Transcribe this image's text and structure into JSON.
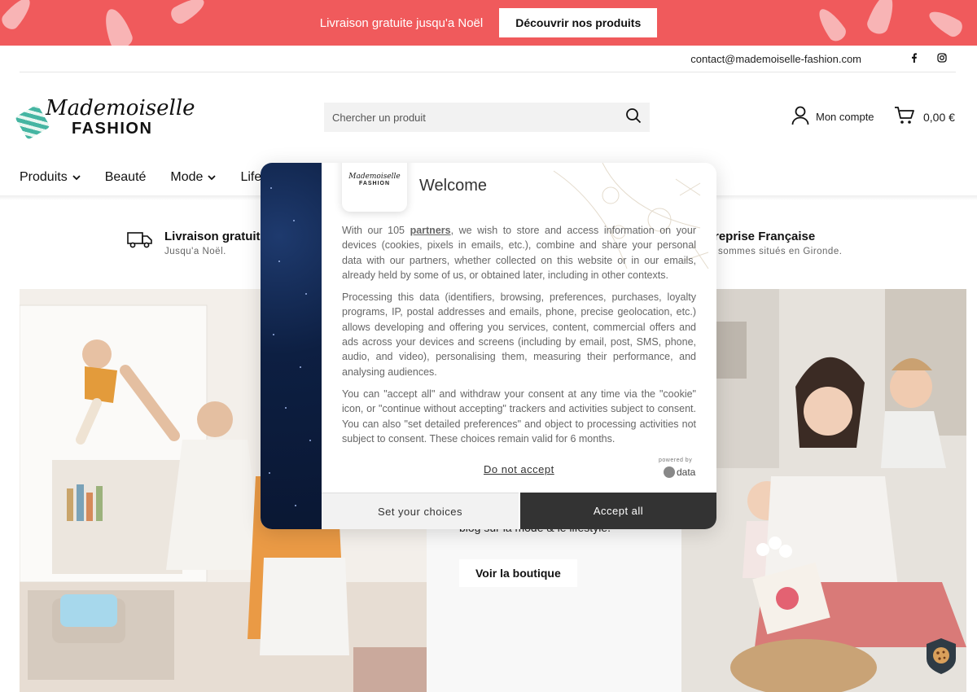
{
  "promo": {
    "text": "Livraison gratuite jusqu'a Noël",
    "button": "Découvrir nos produits"
  },
  "topbar": {
    "contact_email": "contact@mademoiselle-fashion.com",
    "social_icons": [
      "facebook-icon",
      "instagram-icon"
    ]
  },
  "header": {
    "logo_script": "Mademoiselle",
    "logo_word": "FASHION",
    "search_placeholder": "Chercher un produit",
    "account_label": "Mon compte",
    "cart_total": "0,00 €"
  },
  "nav": {
    "items": [
      {
        "label": "Produits",
        "has_dropdown": true
      },
      {
        "label": "Beauté",
        "has_dropdown": false
      },
      {
        "label": "Mode",
        "has_dropdown": true
      },
      {
        "label": "Lifes",
        "has_dropdown": false
      }
    ]
  },
  "features": [
    {
      "title": "Livraison gratuit",
      "subtitle": "Jusqu'a Noël."
    },
    {
      "title": "treprise Française",
      "subtitle": "s sommes situés en Gironde."
    }
  ],
  "hero": {
    "mid_text": "blog sur la mode & le lifestyle.",
    "cta": "Voir la boutique"
  },
  "cookie_modal": {
    "title": "Welcome",
    "logo_script": "Mademoiselle",
    "logo_word": "FASHION",
    "p1_before": "With our 105 ",
    "p1_link": "partners",
    "p1_after": ", we wish to store and access information on your devices (cookies, pixels in emails, etc.), combine and share your personal data with our partners, whether collected on this website or in our emails, already held by some of us, or obtained later, including in other contexts.",
    "p2": "Processing this data (identifiers, browsing, preferences, purchases, loyalty programs, IP, postal addresses and emails, phone, precise geolocation, etc.) allows developing and offering you services, content, commercial offers and ads across your devices and screens (including by email, post, SMS, phone, audio, and video), personalising them, measuring their performance, and analysing audiences.",
    "p3": "You can \"accept all\" and withdraw your consent at any time via the \"cookie\" icon, or \"continue without accepting\" trackers and activities subject to consent. You can also \"set detailed preferences\" and object to processing activities not subject to consent. These choices remain valid for 6 months.",
    "do_not_accept": "Do not accept",
    "powered_by": "powered by",
    "powered_brand": "data",
    "set_choices": "Set your choices",
    "accept_all": "Accept all"
  },
  "colors": {
    "promo_bg": "#f05a5c",
    "accept_bg": "#333333",
    "search_bg": "#f2f2f2"
  }
}
